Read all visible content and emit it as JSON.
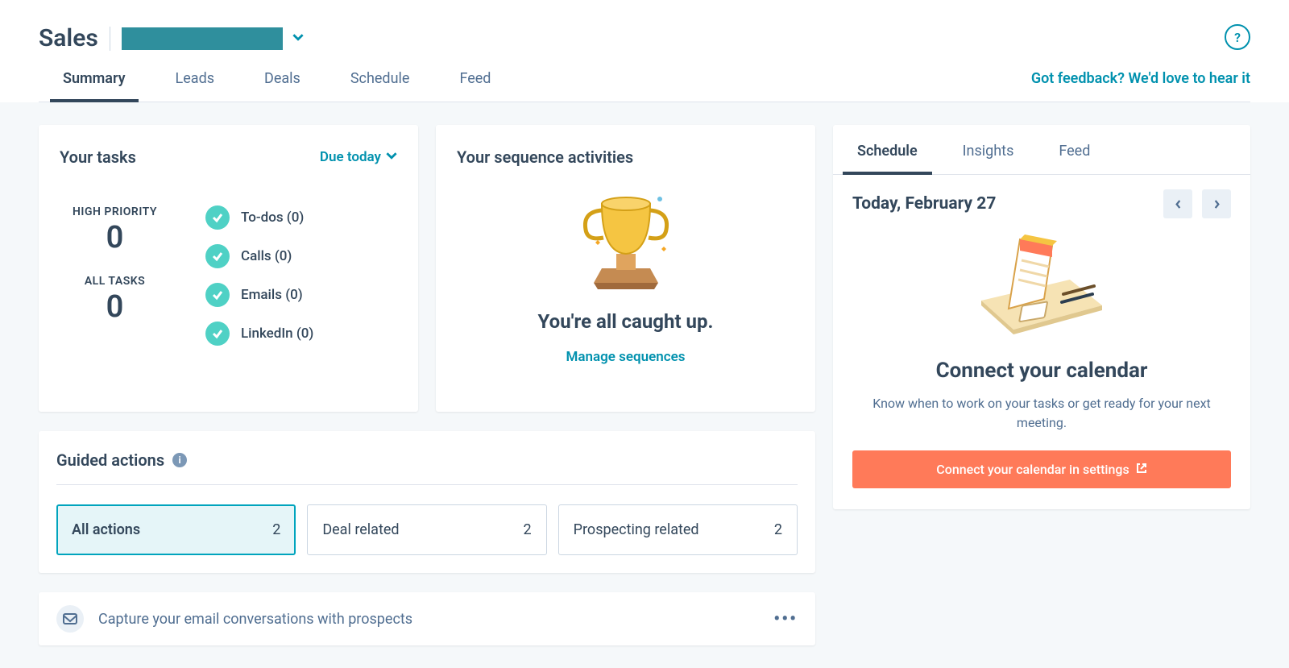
{
  "header": {
    "title": "Sales",
    "help_symbol": "?",
    "feedback_link": "Got feedback? We'd love to hear it"
  },
  "tabs": [
    "Summary",
    "Leads",
    "Deals",
    "Schedule",
    "Feed"
  ],
  "tasks": {
    "title": "Your tasks",
    "due_filter": "Due today",
    "stats": {
      "high_priority_label": "HIGH PRIORITY",
      "high_priority_value": "0",
      "all_tasks_label": "ALL TASKS",
      "all_tasks_value": "0"
    },
    "types": [
      {
        "label": "To-dos (0)"
      },
      {
        "label": "Calls (0)"
      },
      {
        "label": "Emails (0)"
      },
      {
        "label": "LinkedIn (0)"
      }
    ]
  },
  "sequences": {
    "title": "Your sequence activities",
    "caught_up": "You're all caught up.",
    "manage_link": "Manage sequences"
  },
  "guided": {
    "title": "Guided actions",
    "tabs": [
      {
        "label": "All actions",
        "count": "2"
      },
      {
        "label": "Deal related",
        "count": "2"
      },
      {
        "label": "Prospecting related",
        "count": "2"
      }
    ],
    "action_item": "Capture your email conversations with prospects"
  },
  "side": {
    "tabs": [
      "Schedule",
      "Insights",
      "Feed"
    ],
    "date": "Today, February 27",
    "title": "Connect your calendar",
    "description": "Know when to work on your tasks or get ready for your next meeting.",
    "button": "Connect your calendar in settings"
  }
}
